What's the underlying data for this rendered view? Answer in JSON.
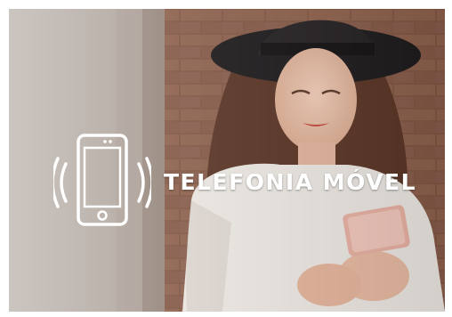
{
  "banner": {
    "title": "TELEFONIA MÓVEL",
    "icon": "smartphone-vibrating-icon",
    "background_image": "woman-with-hat-using-phone-photo"
  },
  "colors": {
    "title_text": "#ffffff",
    "icon_stroke": "#ffffff",
    "brick_tone": "#8a5a44"
  }
}
